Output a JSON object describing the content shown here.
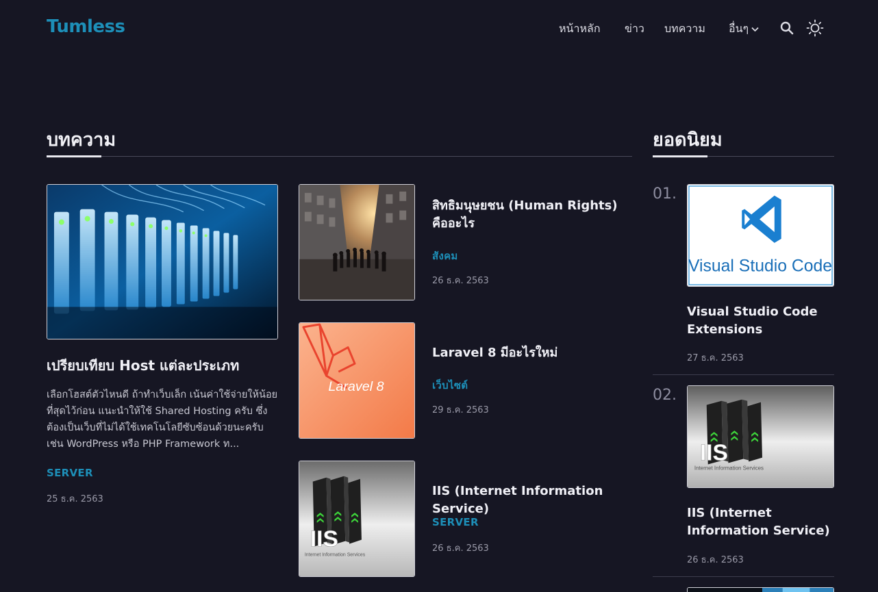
{
  "site": {
    "logo": "Tumless"
  },
  "nav": {
    "home": "หน้าหลัก",
    "news": "ข่าว",
    "articles": "บทความ",
    "more": "อื่นๆ"
  },
  "icons": {
    "search": "search-icon",
    "theme": "sun-icon",
    "chevron": "chevron-down-icon"
  },
  "colors": {
    "accent": "#1d8fb8",
    "background": "#161623"
  },
  "articles": {
    "heading": "บทความ",
    "featured": {
      "title": "เปรียบเทียบ Host แต่ละประเภท",
      "excerpt": "เลือกโฮสต์ตัวไหนดี ถ้าทำเว็บเล็ก เน้นค่าใช้จ่ายให้น้อยที่สุดไว้ก่อน แนะนำให้ใช้ Shared Hosting ครับ ซึ่งต้องเป็นเว็บที่ไม่ได้ใช้เทคโนโลยีซับซ้อนด้วยนะครับ เช่น WordPress หรือ PHP Framework ท...",
      "category": "SERVER",
      "date": "25 ธ.ค. 2563"
    },
    "list": [
      {
        "title": "สิทธิมนุษยชน (Human Rights) คืออะไร",
        "category": "สังคม",
        "date": "26 ธ.ค. 2563"
      },
      {
        "title": "Laravel 8 มีอะไรใหม่",
        "category": "เว็บไซต์",
        "date": "29 ธ.ค. 2563",
        "image_text": "Laravel 8"
      },
      {
        "title": "IIS (Internet Information Service)",
        "category": "SERVER",
        "date": "26 ธ.ค. 2563",
        "image_text": "IIS",
        "image_subtext": "Internet Information Services"
      }
    ]
  },
  "popular": {
    "heading": "ยอดนิยม",
    "items": [
      {
        "rank": "01.",
        "title": "Visual Studio Code Extensions",
        "date": "27 ธ.ค. 2563",
        "image_text": "Visual Studio Code"
      },
      {
        "rank": "02.",
        "title": "IIS (Internet Information Service)",
        "date": "26 ธ.ค. 2563",
        "image_text": "IIS",
        "image_subtext": "Internet Information Services"
      }
    ]
  }
}
